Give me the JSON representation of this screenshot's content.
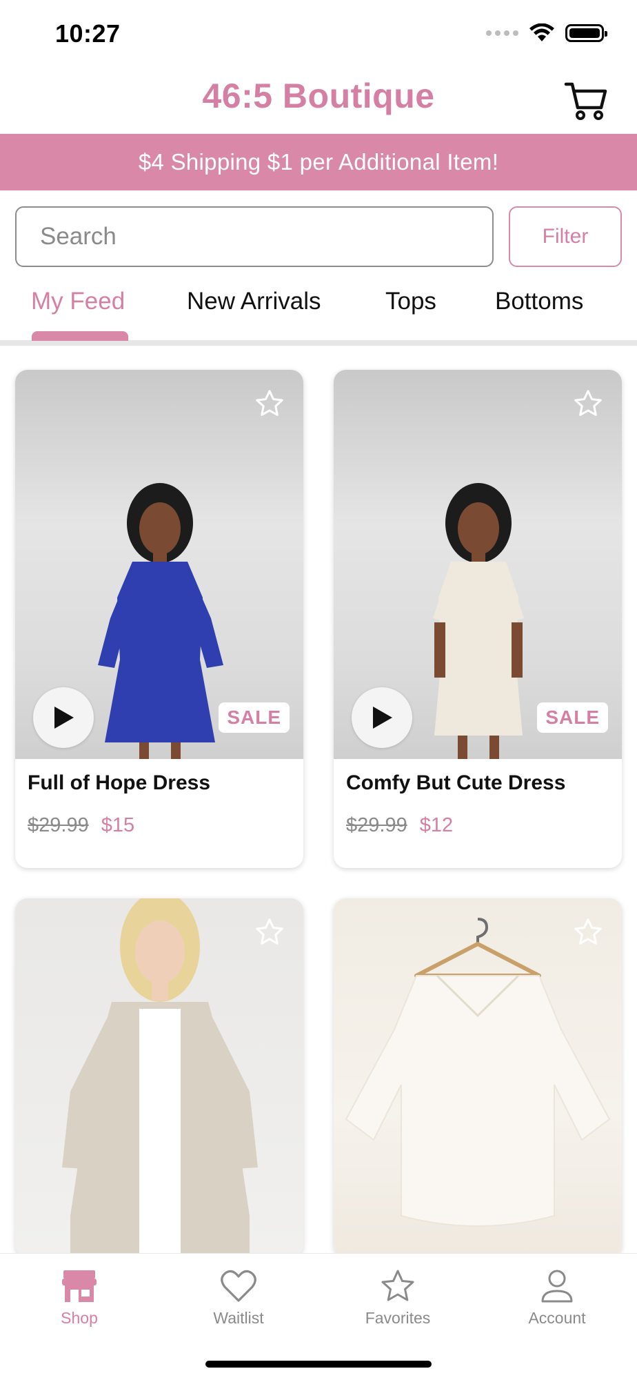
{
  "status_bar": {
    "time": "10:27"
  },
  "header": {
    "title": "46:5 Boutique",
    "cart_icon": "cart-icon"
  },
  "banner": {
    "text": "$4 Shipping $1 per Additional Item!"
  },
  "search": {
    "placeholder": "Search",
    "value": "",
    "filter_label": "Filter"
  },
  "tabs": [
    {
      "label": "My Feed",
      "active": true
    },
    {
      "label": "New Arrivals",
      "active": false
    },
    {
      "label": "Tops",
      "active": false
    },
    {
      "label": "Bottoms",
      "active": false
    }
  ],
  "products": [
    {
      "name": "Full of Hope Dress",
      "old_price": "$29.99",
      "price": "$15",
      "badge": "SALE",
      "has_video": true,
      "garment_color": "#2f3fb0"
    },
    {
      "name": "Comfy But Cute Dress",
      "old_price": "$29.99",
      "price": "$12",
      "badge": "SALE",
      "has_video": true,
      "garment_color": "#efe9dd"
    },
    {
      "name": "",
      "old_price": "",
      "price": "",
      "badge": "",
      "has_video": false,
      "garment_color": "#d8d1c4"
    },
    {
      "name": "",
      "old_price": "",
      "price": "",
      "badge": "",
      "has_video": false,
      "garment_color": "#faf7f2"
    }
  ],
  "bottom_nav": [
    {
      "label": "Shop",
      "icon": "storefront-icon",
      "active": true
    },
    {
      "label": "Waitlist",
      "icon": "heart-icon",
      "active": false
    },
    {
      "label": "Favorites",
      "icon": "star-icon",
      "active": false
    },
    {
      "label": "Account",
      "icon": "person-icon",
      "active": false
    }
  ],
  "colors": {
    "accent": "#d67fa4",
    "banner": "#d988a8",
    "inactive": "#8a8a8a"
  }
}
